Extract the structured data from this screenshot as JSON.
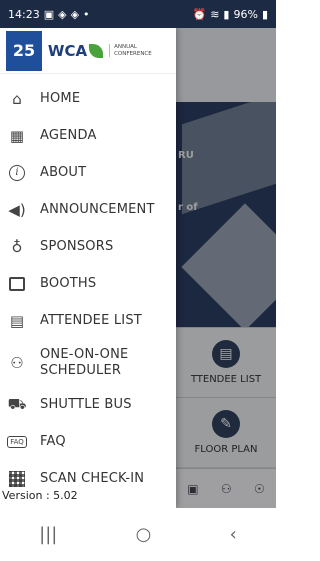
{
  "status_bar": {
    "time": "14:23",
    "notification_icons": [
      "gallery-icon",
      "app-icon",
      "app-icon",
      "dot"
    ],
    "battery": "96%"
  },
  "drawer": {
    "logo_text": "25",
    "brand": "WCA",
    "conference_title": "ANNUAL CONFERENCE",
    "items": [
      {
        "label": "HOME",
        "icon": "home-icon"
      },
      {
        "label": "AGENDA",
        "icon": "calendar-icon"
      },
      {
        "label": "ABOUT",
        "icon": "info-icon"
      },
      {
        "label": "ANNOUNCEMENT",
        "icon": "megaphone-icon"
      },
      {
        "label": "SPONSORS",
        "icon": "badge-icon"
      },
      {
        "label": "BOOTHS",
        "icon": "booth-icon"
      },
      {
        "label": "ATTENDEE LIST",
        "icon": "contact-card-icon"
      },
      {
        "label": "ONE-ON-ONE SCHEDULER",
        "icon": "people-icon"
      },
      {
        "label": "SHUTTLE BUS",
        "icon": "bus-icon"
      },
      {
        "label": "FAQ",
        "icon": "faq-icon"
      },
      {
        "label": "SCAN CHECK-IN",
        "icon": "qr-code-icon"
      }
    ],
    "version": "Version : 5.02"
  },
  "background_app": {
    "banner_text_1": "RU",
    "banner_text_2": "r of",
    "tile_1_label": "TTENDEE LIST",
    "tile_2_label": "FLOOR PLAN"
  },
  "nav_bar": {
    "recents": "|||",
    "home": "○",
    "back": "‹"
  },
  "colors": {
    "status_bar_bg": "#1d2a44",
    "drawer_bg": "#ffffff",
    "brand_blue": "#1f4f9a",
    "brand_green": "#4aa23c"
  }
}
